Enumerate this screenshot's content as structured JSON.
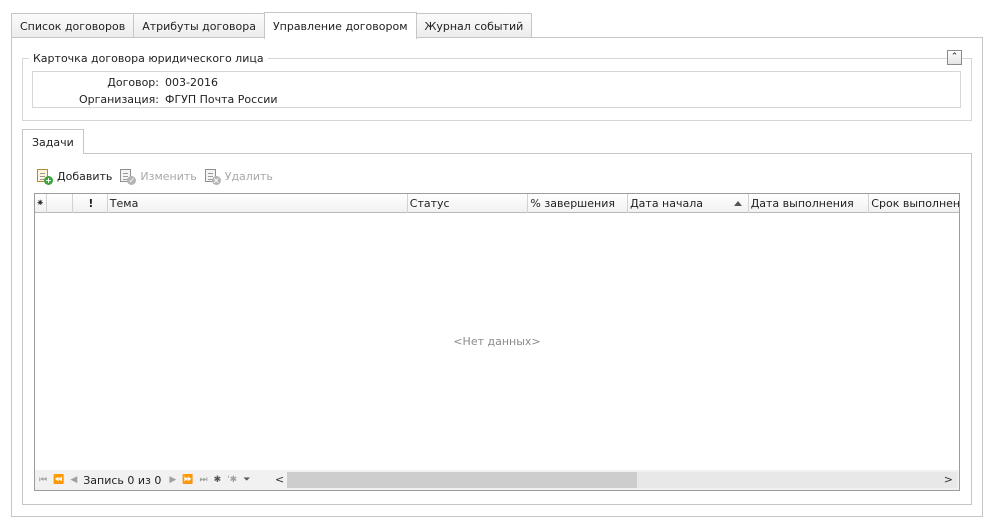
{
  "top_tabs": [
    "Список договоров",
    "Атрибуты договора",
    "Управление договором",
    "Журнал событий"
  ],
  "active_tab": "Управление договором",
  "card": {
    "caption": "Карточка договора юридического лица",
    "contract_label": "Договор:",
    "contract_value": "003-2016",
    "org_label": "Организация:",
    "org_value": "ФГУП Почта России",
    "collapse_glyph": "⌃"
  },
  "tasks_tab": "Задачи",
  "toolbar": {
    "add": "Добавить",
    "edit": "Изменить",
    "delete": "Удалить"
  },
  "grid": {
    "columns": [
      "⁕",
      "",
      "!",
      "Тема",
      "Статус",
      "% завершения",
      "Дата начала",
      "Дата выполнения",
      "Срок выполнения"
    ],
    "sorted_column": "Дата начала",
    "sort_direction": "ascending",
    "empty_text": "<Нет данных>"
  },
  "navigator": {
    "record_text": "Запись 0 из 0"
  }
}
